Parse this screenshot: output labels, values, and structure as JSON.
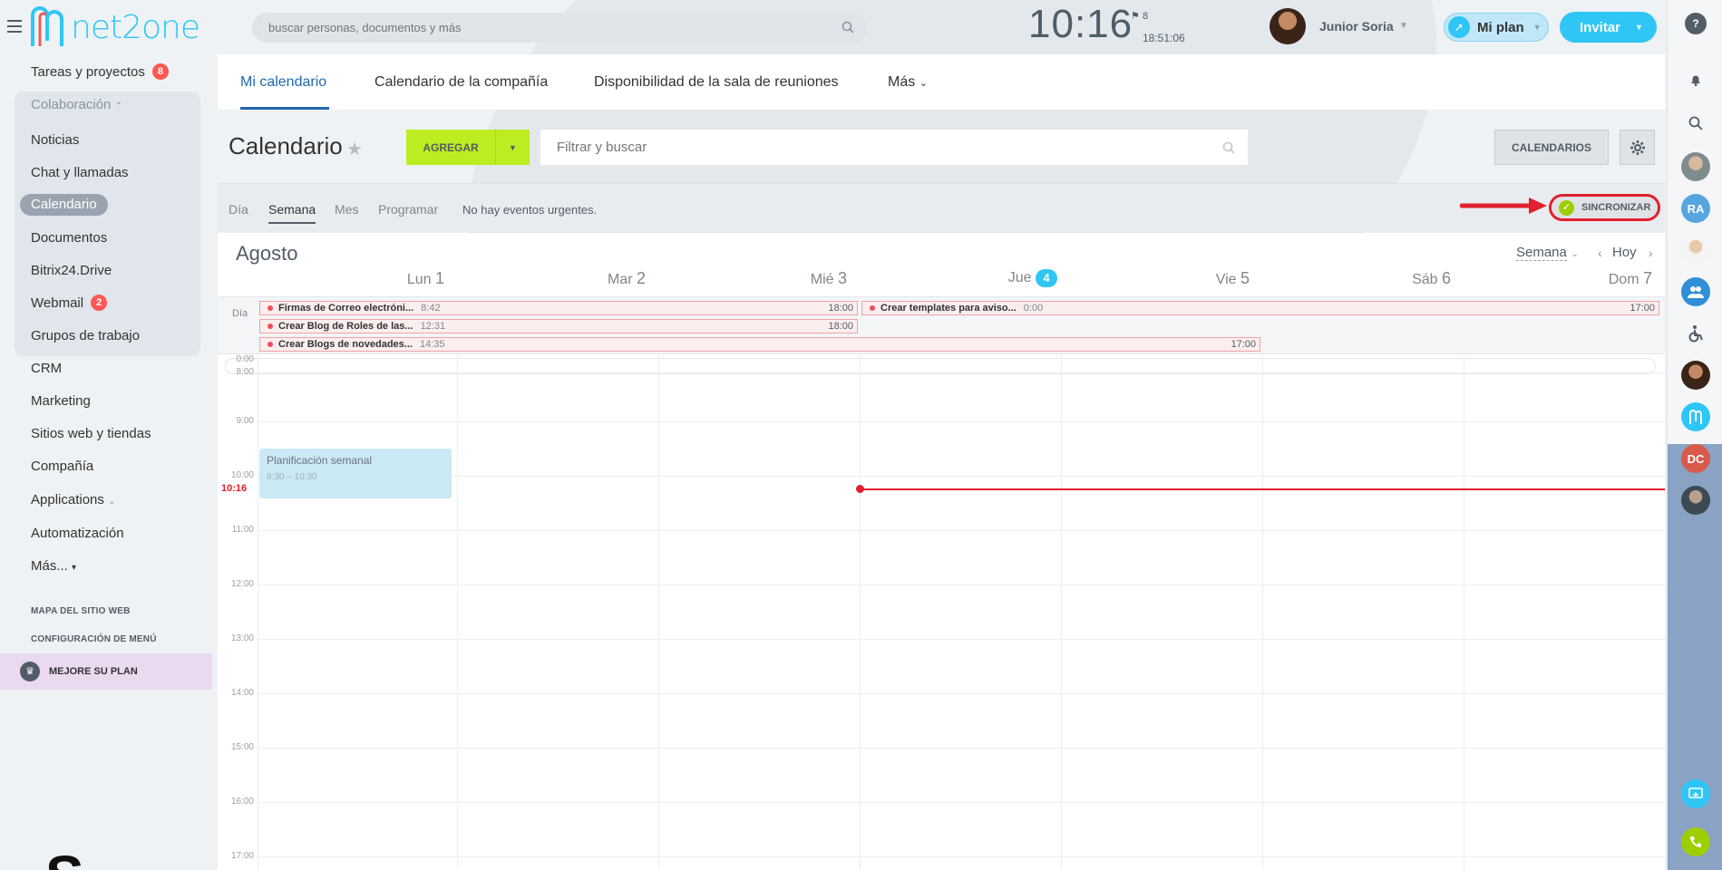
{
  "app": {
    "brand": "net2one",
    "accent": "#2fc6f6"
  },
  "header": {
    "search_placeholder": "buscar personas, documentos y más",
    "clock": "10:16",
    "flag_count": "8",
    "work_time": "18:51:06",
    "user_name": "Junior Soria",
    "plan_label": "Mi plan",
    "invite_label": "Invitar"
  },
  "sidebar": {
    "items": [
      {
        "label": "Tareas y proyectos",
        "badge": "8"
      },
      {
        "label": "Colaboración"
      },
      {
        "label": "Noticias"
      },
      {
        "label": "Chat y llamadas"
      },
      {
        "label": "Calendario"
      },
      {
        "label": "Documentos"
      },
      {
        "label": "Bitrix24.Drive"
      },
      {
        "label": "Webmail",
        "badge": "2"
      },
      {
        "label": "Grupos de trabajo"
      },
      {
        "label": "CRM"
      },
      {
        "label": "Marketing"
      },
      {
        "label": "Sitios web y tiendas"
      },
      {
        "label": "Compañía"
      },
      {
        "label": "Applications"
      },
      {
        "label": "Automatización"
      },
      {
        "label": "Más..."
      }
    ],
    "sitemap": "MAPA DEL SITIO WEB",
    "menu_config": "CONFIGURACIÓN DE MENÚ",
    "upgrade": "MEJORE SU PLAN"
  },
  "tabs": [
    {
      "label": "Mi calendario",
      "active": true
    },
    {
      "label": "Calendario de la compañía"
    },
    {
      "label": "Disponibilidad de la sala de reuniones"
    },
    {
      "label": "Más"
    }
  ],
  "toolbar": {
    "title": "Calendario",
    "add_label": "AGREGAR",
    "filter_placeholder": "Filtrar y buscar",
    "calendars_label": "CALENDARIOS"
  },
  "views": {
    "items": [
      "Día",
      "Semana",
      "Mes",
      "Programar"
    ],
    "active": "Semana",
    "urgent_text": "No hay eventos urgentes.",
    "sync_label": "SINCRONIZAR"
  },
  "calendar": {
    "month": "Agosto",
    "scale": "Semana",
    "today_label": "Hoy",
    "days": [
      {
        "name": "Lun",
        "num": "1"
      },
      {
        "name": "Mar",
        "num": "2"
      },
      {
        "name": "Mié",
        "num": "3"
      },
      {
        "name": "Jue",
        "num": "4",
        "today": true
      },
      {
        "name": "Vie",
        "num": "5"
      },
      {
        "name": "Sáb",
        "num": "6"
      },
      {
        "name": "Dom",
        "num": "7"
      }
    ],
    "allday_label": "Día",
    "allday_events": [
      {
        "title": "Firmas de Correo electróni...",
        "start": "8:42",
        "end": "18:00"
      },
      {
        "title": "Crear Blog de Roles de las...",
        "start": "12:31",
        "end": "18:00"
      },
      {
        "title": "Crear Blogs de novedades...",
        "start": "14:35",
        "end": "17:00"
      },
      {
        "title": "Crear templates para aviso...",
        "start": "0:00",
        "end": "17:00"
      }
    ],
    "hours": [
      "0:00",
      "8:00",
      "9:00",
      "10:00",
      "11:00",
      "12:00",
      "13:00",
      "14:00",
      "15:00",
      "16:00",
      "17:00"
    ],
    "now_label": "10:16",
    "timed_events": [
      {
        "title": "Planificación semanal",
        "time": "9:30 – 10:30"
      }
    ]
  },
  "rightbar": {
    "initials": [
      "RA",
      "DC"
    ]
  }
}
